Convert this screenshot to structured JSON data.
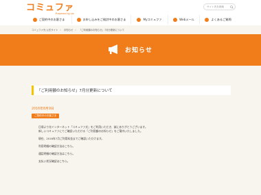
{
  "brand": {
    "name": "コミュファ",
    "tagline": "Powered by ctc"
  },
  "search": {
    "placeholder": "サイト内を検索"
  },
  "nav": [
    {
      "label": "ご契約中のお客さま"
    },
    {
      "label": "お申し込みをご検討中のお客さま"
    },
    {
      "label": "Myコミュファ"
    },
    {
      "label": "Webメール"
    },
    {
      "label": "よくあるご質問"
    }
  ],
  "breadcrumb": [
    "コミュファ光 公式サイト",
    "お知らせ",
    "「ご利用額のお知らせ」7月分更新について"
  ],
  "banner": {
    "title": "お知らせ",
    "icon": "megaphone-icon"
  },
  "article": {
    "title": "「ご利用額のお知らせ」7月分更新について",
    "date": "2016年8月9日",
    "tag": "ご契約中のお客さま",
    "paragraphs": [
      "日頃より光インターネット「コミュファ光」をご利用いただき、誠にありがとうございます。",
      "新しいコミュファにてご確認いただける「ご利用額のお知らせ」をご案内いたしました。",
      "現在、2016年7月ご利用料金までご確認いただけます。",
      "利用明細の確認方法はこちら。",
      "通話明細の確認方法はこちら。",
      "支払い状況確認はこちら。"
    ]
  },
  "colors": {
    "accent": "#f07d1a",
    "highlight": "#f6c400",
    "background": "#f8f4ee"
  }
}
